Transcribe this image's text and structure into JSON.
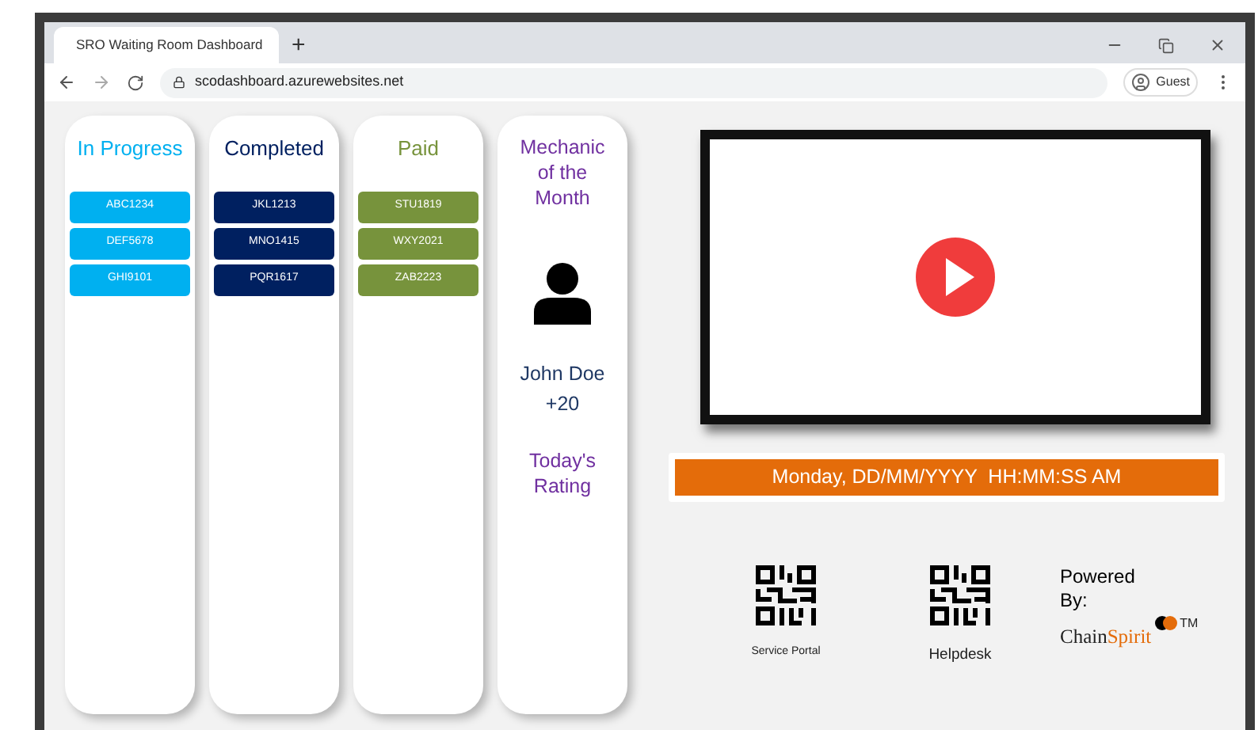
{
  "browser": {
    "tab_title": "SRO Waiting Room Dashboard",
    "new_tab": "+",
    "url": "scodashboard.azurewebsites.net",
    "profile": "Guest"
  },
  "columns": [
    {
      "title": "In Progress",
      "color": "#00b0f0",
      "items": [
        "ABC1234",
        "DEF5678",
        "GHI9101"
      ]
    },
    {
      "title": "Completed",
      "color": "#002060",
      "items": [
        "JKL1213",
        "MNO1415",
        "PQR1617"
      ]
    },
    {
      "title": "Paid",
      "color": "#77933c",
      "items": [
        "STU1819",
        "WXY2021",
        "ZAB2223"
      ]
    }
  ],
  "mechanic": {
    "heading": "Mechanic of the Month",
    "name": "John Doe",
    "score": "+20",
    "rating_label": "Today's Rating"
  },
  "datetime": "Monday, DD/MM/YYYY  HH:MM:SS AM",
  "links": [
    {
      "label": "Service Portal"
    },
    {
      "label": "Helpdesk"
    }
  ],
  "powered_by": {
    "label": "Powered By:",
    "brand_first": "Chain",
    "brand_second": "Spirit",
    "trademark": "TM"
  }
}
